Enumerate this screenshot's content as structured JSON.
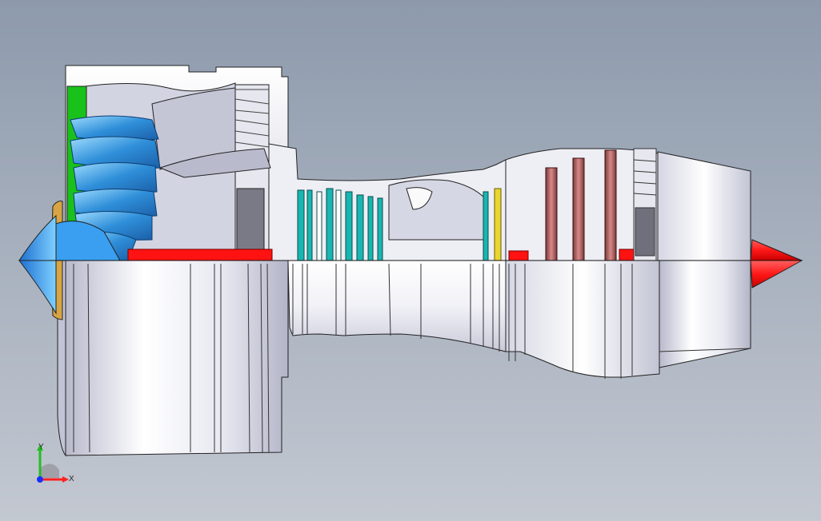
{
  "viewport": {
    "background_top": "#8d9aac",
    "background_bottom": "#c3c8d1"
  },
  "model": {
    "upper_half": "section-view",
    "lower_half": "exterior-view",
    "colors": {
      "shell_light": "#ffffff",
      "shell_mid": "#d9dae6",
      "shell_dark": "#9fa1b6",
      "fan_blade": "#2f8fd9",
      "fan_blade_light": "#8fd0ff",
      "spinner_blue": "#3a9ff0",
      "fan_frame_green": "#19c21b",
      "spinner_ring": "#d8a544",
      "shaft_red": "#ff1212",
      "ipc_blades": "#18b6b1",
      "hpt_vane_yellow": "#e9d530",
      "turbine_blades": "#b86a6a",
      "exhaust_cone": "#ff1818",
      "edge": "#222222"
    }
  },
  "triad": {
    "x_label": "X",
    "y_label": "Y",
    "x_color": "#ff2020",
    "y_color": "#20c020",
    "z_color": "#1a2fff"
  }
}
